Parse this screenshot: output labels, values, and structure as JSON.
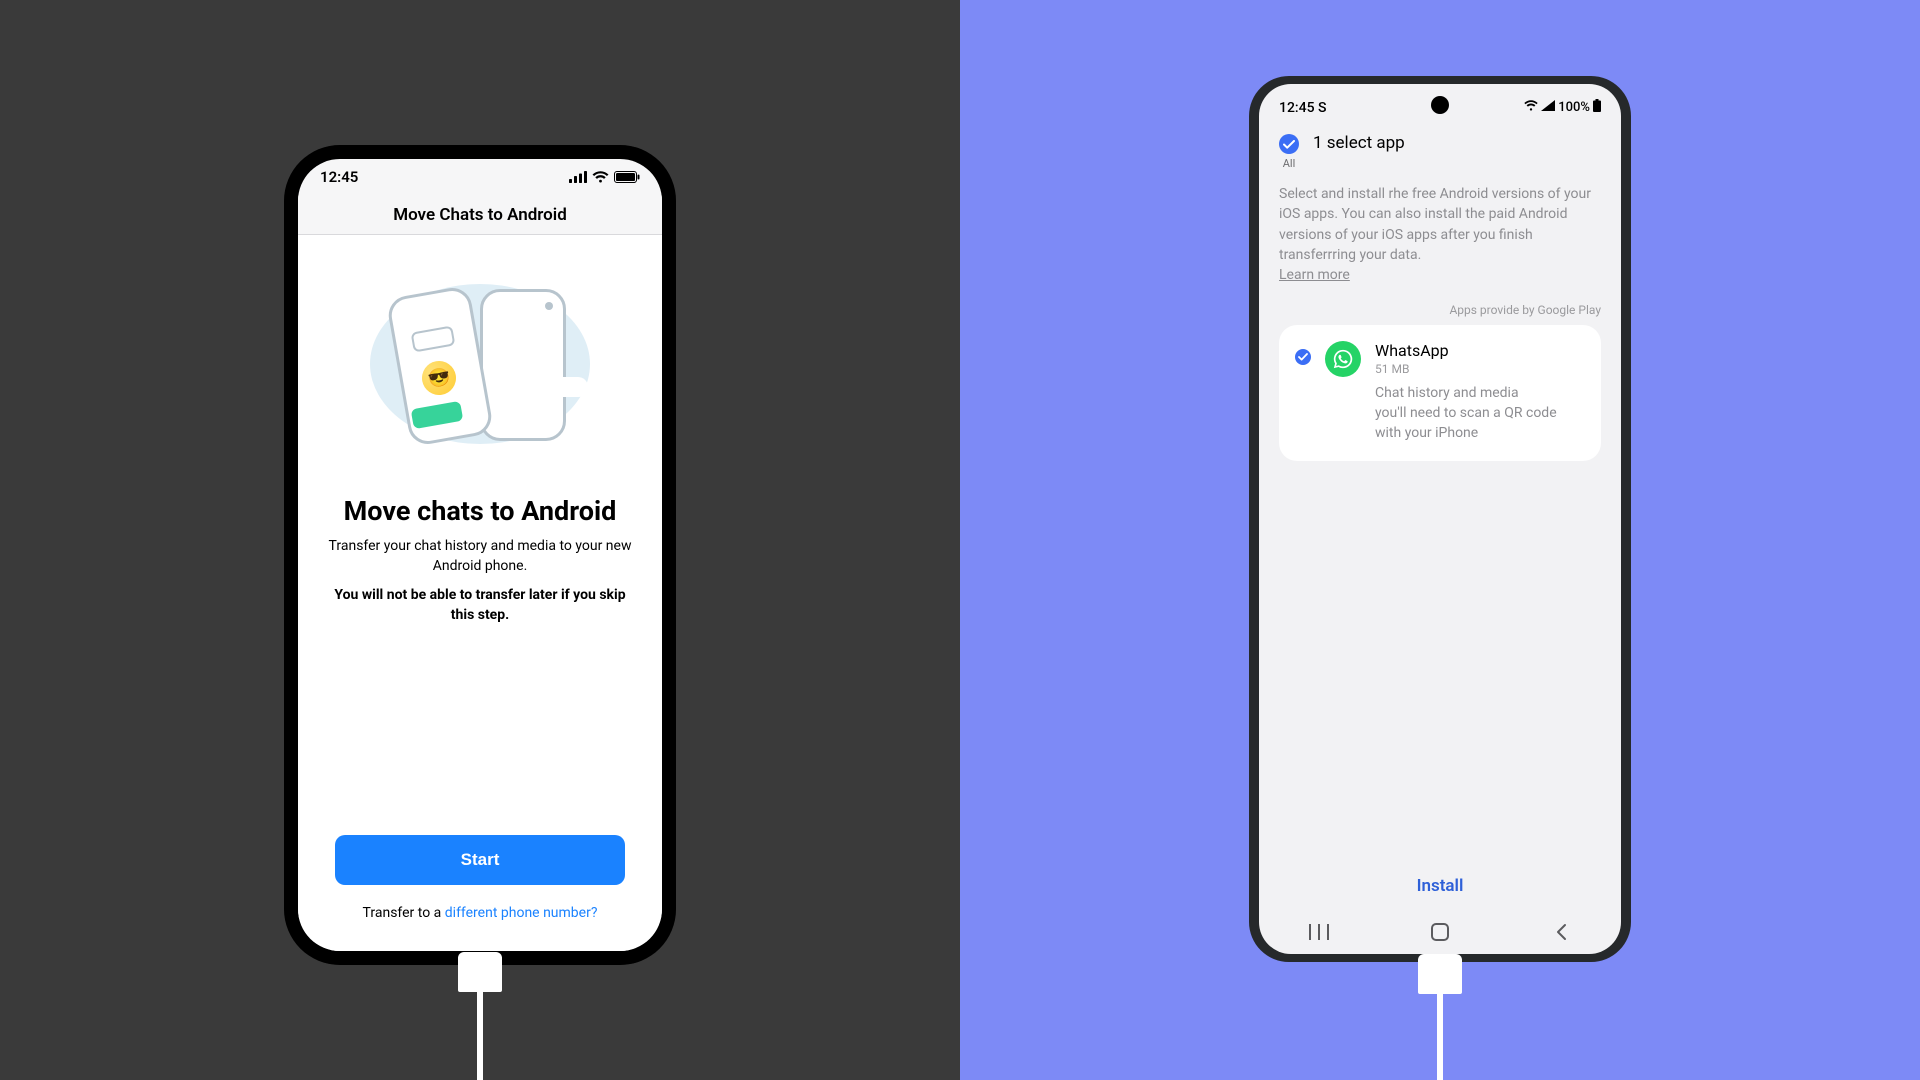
{
  "left": {
    "statusbar_time": "12:45",
    "navbar_title": "Move Chats to Android",
    "heading": "Move chats to Android",
    "subheading": "Transfer your chat history and media to your new Android phone.",
    "warning": "You will not be able to transfer later if you skip this step.",
    "start_label": "Start",
    "transfer_prefix": "Transfer to a ",
    "transfer_link": "different phone number?"
  },
  "right": {
    "statusbar_time": "12:45 S",
    "statusbar_battery": "100%",
    "all_label": "All",
    "select_title": "1 select app",
    "help_text": "Select and install rhe free Android versions of your iOS apps. You can also install the paid Android versions of your iOS apps after you finish transferrring your data.",
    "learn_more": "Learn more",
    "provider": "Apps provide by Google Play",
    "app": {
      "name": "WhatsApp",
      "size": "51 MB",
      "desc1": "Chat history and media",
      "desc2": "you'll need to scan a QR code with your iPhone"
    },
    "install_label": "Install"
  }
}
